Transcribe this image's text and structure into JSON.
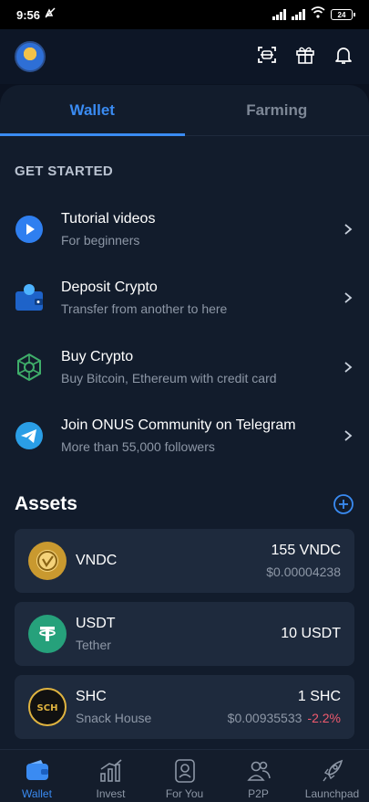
{
  "status_bar": {
    "time": "9:56",
    "battery": "24"
  },
  "header": {
    "icons": [
      "scan-icon",
      "gift-icon",
      "bell-icon"
    ]
  },
  "tabs": [
    {
      "label": "Wallet",
      "active": true
    },
    {
      "label": "Farming",
      "active": false
    }
  ],
  "get_started": {
    "title": "GET STARTED",
    "items": [
      {
        "title": "Tutorial videos",
        "subtitle": "For beginners",
        "icon": "play-icon"
      },
      {
        "title": "Deposit Crypto",
        "subtitle": "Transfer from another to here",
        "icon": "wallet-deposit-icon"
      },
      {
        "title": "Buy Crypto",
        "subtitle": "Buy Bitcoin, Ethereum with credit card",
        "icon": "crypto-network-icon"
      },
      {
        "title": "Join ONUS Community on Telegram",
        "subtitle": "More than 55,000 followers",
        "icon": "telegram-icon"
      }
    ]
  },
  "assets": {
    "title": "Assets",
    "items": [
      {
        "symbol": "VNDC",
        "name": "",
        "amount": "155 VNDC",
        "usd": "$0.00004238",
        "change": ""
      },
      {
        "symbol": "USDT",
        "name": "Tether",
        "amount": "10 USDT",
        "usd": "",
        "change": ""
      },
      {
        "symbol": "SHC",
        "name": "Snack House",
        "amount": "1 SHC",
        "usd": "$0.00935533",
        "change": "-2.2%"
      }
    ]
  },
  "nav": [
    {
      "label": "Wallet",
      "icon": "wallet-icon",
      "active": true
    },
    {
      "label": "Invest",
      "icon": "chart-icon",
      "active": false
    },
    {
      "label": "For You",
      "icon": "person-card-icon",
      "active": false
    },
    {
      "label": "P2P",
      "icon": "people-icon",
      "active": false
    },
    {
      "label": "Launchpad",
      "icon": "rocket-icon",
      "active": false
    }
  ],
  "colors": {
    "accent": "#3a8bf2",
    "negative": "#f05a6e",
    "background": "#0b1220",
    "card": "#1e2a3d"
  }
}
